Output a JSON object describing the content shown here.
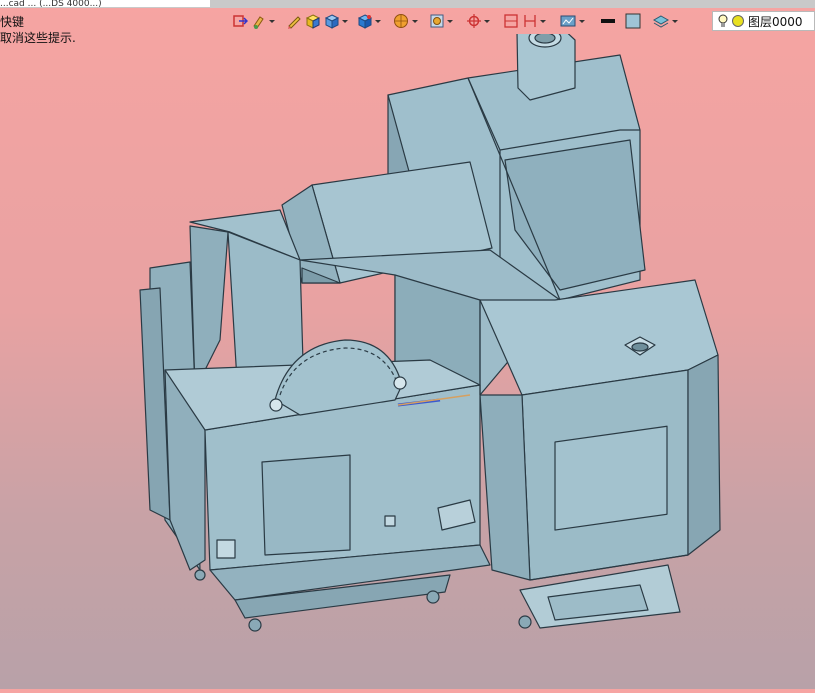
{
  "window": {
    "title_fragment": "...cad ... (...DS 4000...)"
  },
  "hints": {
    "line1": "快键",
    "line2": "取消这些提示."
  },
  "toolbar": {
    "buttons": [
      {
        "name": "exit-sketch-icon"
      },
      {
        "name": "paint-brush-icon"
      },
      {
        "name": "pencil-edit-icon"
      },
      {
        "name": "cube-yellow-icon"
      },
      {
        "name": "cube-blue-icon"
      },
      {
        "name": "cube-view-icon"
      },
      {
        "name": "sphere-render-icon"
      },
      {
        "name": "shading-mode-icon"
      },
      {
        "name": "crosshair-icon"
      },
      {
        "name": "section-view-icon"
      },
      {
        "name": "dimension-icon"
      },
      {
        "name": "assembly-icon"
      },
      {
        "name": "line-color-icon"
      },
      {
        "name": "fill-color-icon"
      },
      {
        "name": "layers-icon"
      }
    ]
  },
  "layer": {
    "label": "图层0000",
    "line_color": "#111111",
    "fill_color": "#9fc4d6"
  },
  "model": {
    "body_color": "#9fbfcc",
    "edge_color": "#2a3a44",
    "description": "machining center 3D assembly"
  }
}
